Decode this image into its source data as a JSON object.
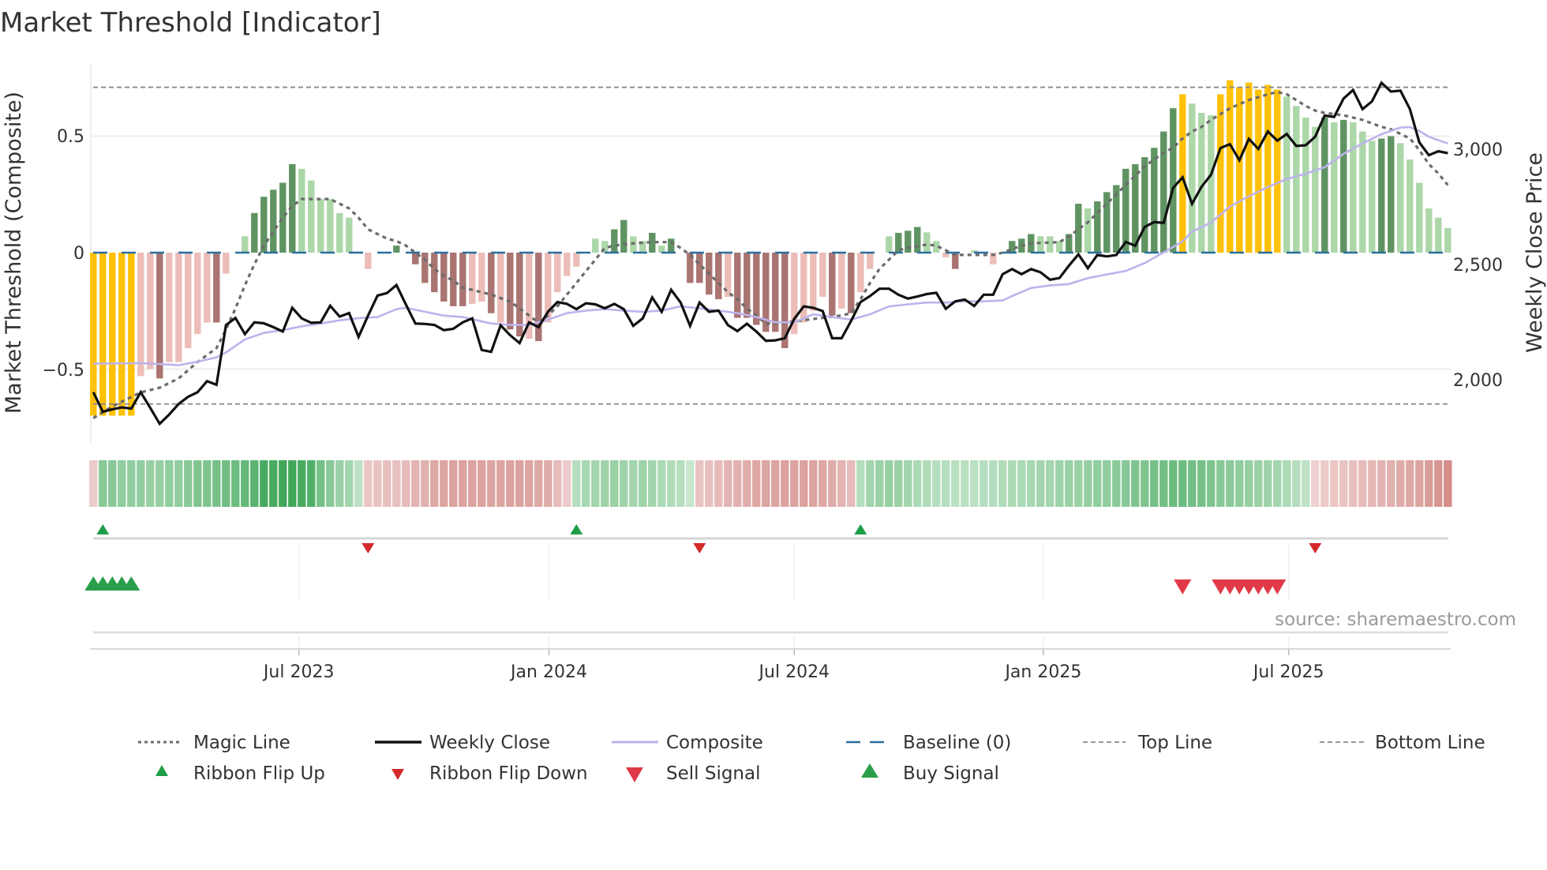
{
  "chart_data": {
    "type": "bar+line",
    "title": "Market Threshold [Indicator]",
    "ylabel_left": "Market Threshold (Composite)",
    "ylabel_right": "Weekly Close Price",
    "x_unit": "week index",
    "ylim_left": [
      -0.81,
      0.81
    ],
    "ylim_right": [
      1730,
      3370
    ],
    "grid": true,
    "left_ticks": [
      {
        "value": 0.5,
        "label": "0.5"
      },
      {
        "value": 0,
        "label": "0"
      },
      {
        "value": -0.5,
        "label": "−0.5"
      }
    ],
    "right_ticks": [
      {
        "value": 3000,
        "label": "3,000"
      },
      {
        "value": 2500,
        "label": "2,500"
      },
      {
        "value": 2000,
        "label": "2,000"
      }
    ],
    "x_ticks": [
      {
        "week": 21.7,
        "label": "Jul 2023"
      },
      {
        "week": 48.1,
        "label": "Jan 2024"
      },
      {
        "week": 74.0,
        "label": "Jul 2024"
      },
      {
        "week": 100.3,
        "label": "Jan 2025"
      },
      {
        "week": 126.2,
        "label": "Jul 2025"
      }
    ],
    "top_line": 0.71,
    "bottom_line": -0.65,
    "baseline": 0,
    "colors": {
      "Y": "#ffc107",
      "DG": "#5f9462",
      "LG": "#acd7a8",
      "DR": "#a97471",
      "LR": "#ecbdb8",
      "magic": "#6b6b6b",
      "close": "#111111",
      "composite": "#bdb3ec",
      "baseline": "#2a6f9e",
      "threshold": "#8a8a8a",
      "flip_up": "#1f9e4a",
      "flip_down": "#d42a2a",
      "sell": "#e03a48",
      "buy": "#2a9e4a"
    },
    "composite_bars": {
      "values": [
        -0.7,
        -0.7,
        -0.7,
        -0.7,
        -0.7,
        -0.53,
        -0.5,
        -0.54,
        -0.47,
        -0.47,
        -0.41,
        -0.35,
        -0.3,
        -0.3,
        -0.09,
        0,
        0.07,
        0.17,
        0.24,
        0.27,
        0.3,
        0.38,
        0.36,
        0.31,
        0.23,
        0.23,
        0.17,
        0.15,
        0,
        -0.07,
        0,
        0,
        0.03,
        0,
        -0.05,
        -0.13,
        -0.17,
        -0.21,
        -0.23,
        -0.23,
        -0.22,
        -0.21,
        -0.26,
        -0.3,
        -0.33,
        -0.36,
        -0.37,
        -0.38,
        -0.3,
        -0.17,
        -0.1,
        -0.06,
        0,
        0.06,
        0.05,
        0.1,
        0.14,
        0.07,
        0.05,
        0.085,
        0.03,
        0.06,
        0,
        -0.13,
        -0.13,
        -0.18,
        -0.2,
        -0.19,
        -0.28,
        -0.28,
        -0.31,
        -0.34,
        -0.34,
        -0.41,
        -0.35,
        -0.3,
        -0.25,
        -0.19,
        -0.27,
        -0.24,
        -0.26,
        -0.17,
        -0.07,
        0,
        0.07,
        0.085,
        0.094,
        0.11,
        0.087,
        0.05,
        -0.02,
        -0.07,
        0,
        0.01,
        0,
        -0.05,
        0,
        0.05,
        0.06,
        0.08,
        0.07,
        0.07,
        0.05,
        0.08,
        0.21,
        0.19,
        0.22,
        0.26,
        0.29,
        0.36,
        0.38,
        0.41,
        0.45,
        0.52,
        0.62,
        0.68,
        0.64,
        0.6,
        0.59,
        0.68,
        0.74,
        0.71,
        0.73,
        0.7,
        0.72,
        0.7,
        0.67,
        0.63,
        0.58,
        0.54,
        0.58,
        0.56,
        0.57,
        0.56,
        0.52,
        0.48,
        0.49,
        0.5,
        0.47,
        0.4,
        0.3,
        0.19,
        0.15,
        0.105
      ],
      "color_codes": [
        "Y",
        "Y",
        "Y",
        "Y",
        "Y",
        "LR",
        "LR",
        "DR",
        "LR",
        "LR",
        "LR",
        "LR",
        "LR",
        "DR",
        "LR",
        "LR",
        "LG",
        "DG",
        "DG",
        "DG",
        "DG",
        "DG",
        "LG",
        "LG",
        "LG",
        "LG",
        "LG",
        "LG",
        "LR",
        "LR",
        "LR",
        "LR",
        "DG",
        "DR",
        "DR",
        "DR",
        "DR",
        "DR",
        "DR",
        "DR",
        "LR",
        "LR",
        "DR",
        "LR",
        "DR",
        "DR",
        "LR",
        "DR",
        "LR",
        "LR",
        "LR",
        "LR",
        "LG",
        "LG",
        "LG",
        "DG",
        "DG",
        "LG",
        "LG",
        "DG",
        "LG",
        "DG",
        "DR",
        "DR",
        "DR",
        "DR",
        "DR",
        "LR",
        "DR",
        "DR",
        "DR",
        "DR",
        "DR",
        "DR",
        "LR",
        "LR",
        "LR",
        "LR",
        "DR",
        "LR",
        "DR",
        "LR",
        "LR",
        "LG",
        "LG",
        "DG",
        "DG",
        "DG",
        "LG",
        "LG",
        "LR",
        "DR",
        "LG",
        "LG",
        "LR",
        "LR",
        "DG",
        "DG",
        "DG",
        "DG",
        "LG",
        "LG",
        "LG",
        "DG",
        "DG",
        "LG",
        "DG",
        "DG",
        "DG",
        "DG",
        "DG",
        "DG",
        "DG",
        "DG",
        "DG",
        "Y",
        "LG",
        "LG",
        "LG",
        "Y",
        "Y",
        "Y",
        "Y",
        "Y",
        "Y",
        "Y",
        "LG",
        "LG",
        "LG",
        "LG",
        "DG",
        "LG",
        "DG",
        "LG",
        "LG",
        "LG",
        "DG",
        "DG",
        "LG",
        "LG",
        "LG",
        "LG",
        "LG",
        "LG"
      ]
    },
    "weekly_close": [
      1946,
      1861,
      1872,
      1880,
      1875,
      1946,
      1878,
      1809,
      1849,
      1895,
      1926,
      1946,
      1994,
      1978,
      2237,
      2268,
      2198,
      2249,
      2245,
      2228,
      2209,
      2312,
      2266,
      2247,
      2249,
      2321,
      2274,
      2289,
      2186,
      2278,
      2365,
      2376,
      2411,
      2326,
      2244,
      2242,
      2238,
      2215,
      2221,
      2249,
      2266,
      2129,
      2121,
      2236,
      2193,
      2159,
      2249,
      2228,
      2295,
      2337,
      2329,
      2306,
      2332,
      2327,
      2310,
      2329,
      2306,
      2234,
      2266,
      2357,
      2295,
      2390,
      2335,
      2234,
      2335,
      2295,
      2300,
      2237,
      2211,
      2243,
      2209,
      2169,
      2171,
      2180,
      2264,
      2318,
      2312,
      2298,
      2180,
      2180,
      2255,
      2337,
      2363,
      2395,
      2395,
      2369,
      2352,
      2361,
      2372,
      2377,
      2308,
      2340,
      2348,
      2320,
      2369,
      2369,
      2458,
      2480,
      2458,
      2480,
      2466,
      2434,
      2441,
      2495,
      2544,
      2484,
      2541,
      2535,
      2541,
      2598,
      2581,
      2663,
      2684,
      2680,
      2832,
      2878,
      2763,
      2837,
      2889,
      3005,
      3022,
      2952,
      3045,
      3001,
      3077,
      3037,
      3066,
      3014,
      3017,
      3054,
      3146,
      3140,
      3220,
      3257,
      3174,
      3208,
      3288,
      3250,
      3254,
      3174,
      3029,
      2974,
      2991,
      2983
    ],
    "composite_line": [
      [
        0,
        2070
      ],
      [
        5,
        2072
      ],
      [
        7,
        2068
      ],
      [
        9,
        2063
      ],
      [
        11,
        2078
      ],
      [
        13,
        2097
      ],
      [
        14,
        2118
      ],
      [
        16,
        2175
      ],
      [
        18,
        2203
      ],
      [
        20,
        2215
      ],
      [
        22,
        2232
      ],
      [
        24,
        2244
      ],
      [
        26,
        2258
      ],
      [
        28,
        2267
      ],
      [
        30,
        2272
      ],
      [
        32,
        2306
      ],
      [
        33,
        2312
      ],
      [
        35,
        2295
      ],
      [
        37,
        2278
      ],
      [
        39,
        2272
      ],
      [
        42,
        2244
      ],
      [
        44,
        2238
      ],
      [
        46,
        2238
      ],
      [
        48,
        2261
      ],
      [
        50,
        2289
      ],
      [
        52,
        2300
      ],
      [
        54,
        2306
      ],
      [
        56,
        2300
      ],
      [
        58,
        2295
      ],
      [
        60,
        2300
      ],
      [
        62,
        2318
      ],
      [
        64,
        2310
      ],
      [
        66,
        2300
      ],
      [
        68,
        2289
      ],
      [
        70,
        2272
      ],
      [
        72,
        2249
      ],
      [
        74,
        2249
      ],
      [
        76,
        2284
      ],
      [
        78,
        2272
      ],
      [
        80,
        2261
      ],
      [
        82,
        2284
      ],
      [
        84,
        2318
      ],
      [
        86,
        2327
      ],
      [
        88,
        2335
      ],
      [
        90,
        2335
      ],
      [
        92,
        2340
      ],
      [
        94,
        2340
      ],
      [
        96,
        2344
      ],
      [
        97,
        2363
      ],
      [
        99,
        2398
      ],
      [
        101,
        2409
      ],
      [
        103,
        2415
      ],
      [
        105,
        2441
      ],
      [
        107,
        2457
      ],
      [
        109,
        2472
      ],
      [
        111,
        2506
      ],
      [
        113,
        2552
      ],
      [
        115,
        2600
      ],
      [
        116,
        2642
      ],
      [
        118,
        2682
      ],
      [
        120,
        2751
      ],
      [
        122,
        2796
      ],
      [
        124,
        2836
      ],
      [
        126,
        2871
      ],
      [
        128,
        2894
      ],
      [
        130,
        2922
      ],
      [
        132,
        2980
      ],
      [
        134,
        3025
      ],
      [
        136,
        3065
      ],
      [
        138,
        3094
      ],
      [
        139,
        3096
      ],
      [
        140,
        3079
      ],
      [
        141,
        3054
      ],
      [
        142,
        3039
      ],
      [
        143,
        3025
      ]
    ],
    "magic_line": [
      [
        0,
        -0.71
      ],
      [
        2,
        -0.66
      ],
      [
        5,
        -0.6
      ],
      [
        7,
        -0.58
      ],
      [
        9,
        -0.54
      ],
      [
        11,
        -0.47
      ],
      [
        13,
        -0.41
      ],
      [
        14,
        -0.33
      ],
      [
        15,
        -0.24
      ],
      [
        16,
        -0.14
      ],
      [
        17,
        -0.05
      ],
      [
        18,
        0.03
      ],
      [
        19,
        0.09
      ],
      [
        20,
        0.15
      ],
      [
        21,
        0.2
      ],
      [
        22,
        0.23
      ],
      [
        25,
        0.23
      ],
      [
        26,
        0.21
      ],
      [
        27,
        0.19
      ],
      [
        28,
        0.15
      ],
      [
        29,
        0.1
      ],
      [
        30,
        0.08
      ],
      [
        31,
        0.06
      ],
      [
        32,
        0.05
      ],
      [
        33,
        0.03
      ],
      [
        34,
        0
      ],
      [
        35,
        -0.03
      ],
      [
        36,
        -0.07
      ],
      [
        37,
        -0.1
      ],
      [
        38,
        -0.12
      ],
      [
        39,
        -0.15
      ],
      [
        40,
        -0.16
      ],
      [
        42,
        -0.18
      ],
      [
        44,
        -0.21
      ],
      [
        46,
        -0.27
      ],
      [
        47,
        -0.3
      ],
      [
        48,
        -0.27
      ],
      [
        49,
        -0.23
      ],
      [
        50,
        -0.18
      ],
      [
        51,
        -0.13
      ],
      [
        52,
        -0.08
      ],
      [
        53,
        -0.03
      ],
      [
        54,
        0.02
      ],
      [
        55,
        0.03
      ],
      [
        57,
        0.04
      ],
      [
        59,
        0.045
      ],
      [
        61,
        0.045
      ],
      [
        62,
        0.02
      ],
      [
        63,
        -0.01
      ],
      [
        64,
        -0.05
      ],
      [
        65,
        -0.09
      ],
      [
        66,
        -0.13
      ],
      [
        67,
        -0.17
      ],
      [
        68,
        -0.2
      ],
      [
        69,
        -0.24
      ],
      [
        70,
        -0.27
      ],
      [
        71,
        -0.305
      ],
      [
        73,
        -0.3
      ],
      [
        75,
        -0.29
      ],
      [
        77,
        -0.28
      ],
      [
        79,
        -0.27
      ],
      [
        80,
        -0.26
      ],
      [
        81,
        -0.2
      ],
      [
        82,
        -0.13
      ],
      [
        83,
        -0.07
      ],
      [
        84,
        -0.03
      ],
      [
        85,
        0.01
      ],
      [
        86,
        0.02
      ],
      [
        88,
        0.035
      ],
      [
        89,
        0.03
      ],
      [
        90,
        0.01
      ],
      [
        91,
        -0.01
      ],
      [
        95,
        -0.01
      ],
      [
        96,
        0
      ],
      [
        97,
        0.015
      ],
      [
        98,
        0.03
      ],
      [
        99,
        0.04
      ],
      [
        102,
        0.045
      ],
      [
        103,
        0.07
      ],
      [
        104,
        0.1
      ],
      [
        105,
        0.13
      ],
      [
        106,
        0.17
      ],
      [
        107,
        0.21
      ],
      [
        108,
        0.25
      ],
      [
        109,
        0.29
      ],
      [
        110,
        0.33
      ],
      [
        111,
        0.37
      ],
      [
        112,
        0.4
      ],
      [
        113,
        0.43
      ],
      [
        114,
        0.45
      ],
      [
        115,
        0.49
      ],
      [
        116,
        0.52
      ],
      [
        117,
        0.54
      ],
      [
        118,
        0.57
      ],
      [
        120,
        0.62
      ],
      [
        122,
        0.655
      ],
      [
        124,
        0.68
      ],
      [
        125,
        0.69
      ],
      [
        126,
        0.68
      ],
      [
        127,
        0.655
      ],
      [
        128,
        0.63
      ],
      [
        129,
        0.61
      ],
      [
        130,
        0.6
      ],
      [
        132,
        0.59
      ],
      [
        134,
        0.57
      ],
      [
        136,
        0.54
      ],
      [
        137,
        0.53
      ],
      [
        138,
        0.51
      ],
      [
        139,
        0.49
      ],
      [
        140,
        0.44
      ],
      [
        141,
        0.38
      ],
      [
        142,
        0.34
      ],
      [
        143,
        0.29
      ]
    ],
    "ribbon_strength": [
      -0.15,
      0.5,
      0.5,
      0.45,
      0.45,
      0.45,
      0.42,
      0.42,
      0.45,
      0.45,
      0.5,
      0.55,
      0.55,
      0.6,
      0.62,
      0.65,
      0.7,
      0.75,
      0.85,
      0.85,
      0.9,
      0.9,
      0.85,
      0.8,
      0.6,
      0.5,
      0.4,
      0.35,
      0.2,
      -0.18,
      -0.2,
      -0.22,
      -0.22,
      -0.25,
      -0.3,
      -0.32,
      -0.38,
      -0.4,
      -0.42,
      -0.42,
      -0.42,
      -0.42,
      -0.4,
      -0.4,
      -0.42,
      -0.42,
      -0.4,
      -0.38,
      -0.35,
      -0.25,
      -0.15,
      0.25,
      0.32,
      0.35,
      0.38,
      0.4,
      0.38,
      0.35,
      0.38,
      0.35,
      0.3,
      0.28,
      0.25,
      0.15,
      -0.2,
      -0.22,
      -0.25,
      -0.3,
      -0.32,
      -0.35,
      -0.38,
      -0.4,
      -0.4,
      -0.42,
      -0.42,
      -0.42,
      -0.4,
      -0.38,
      -0.35,
      -0.3,
      -0.25,
      0.25,
      0.35,
      0.4,
      0.42,
      0.4,
      0.35,
      0.3,
      0.28,
      0.25,
      0.25,
      0.22,
      0.22,
      0.22,
      0.25,
      0.25,
      0.28,
      0.3,
      0.3,
      0.32,
      0.35,
      0.35,
      0.38,
      0.4,
      0.4,
      0.42,
      0.45,
      0.45,
      0.48,
      0.5,
      0.55,
      0.55,
      0.6,
      0.62,
      0.65,
      0.65,
      0.62,
      0.6,
      0.55,
      0.5,
      0.48,
      0.45,
      0.42,
      0.4,
      0.38,
      0.35,
      0.3,
      0.25,
      0.2,
      -0.12,
      -0.15,
      -0.18,
      -0.2,
      -0.22,
      -0.25,
      -0.28,
      -0.3,
      -0.32,
      -0.35,
      -0.38,
      -0.4,
      -0.45,
      -0.5,
      -0.55
    ],
    "ribbon_flip_up": [
      1,
      51,
      81
    ],
    "ribbon_flip_down": [
      29,
      64,
      129
    ],
    "buy_signal": [
      0,
      1,
      2,
      3,
      4
    ],
    "sell_signal": [
      115,
      119,
      120,
      121,
      122,
      123,
      124,
      125
    ],
    "legend": {
      "placement": "bottom",
      "items": [
        "Magic Line",
        "Weekly Close",
        "Composite",
        "Baseline (0)",
        "Top Line",
        "Bottom Line",
        "Ribbon Flip Up",
        "Ribbon Flip Down",
        "Sell Signal",
        "Buy Signal"
      ]
    },
    "source": "source: sharemaestro.com"
  }
}
